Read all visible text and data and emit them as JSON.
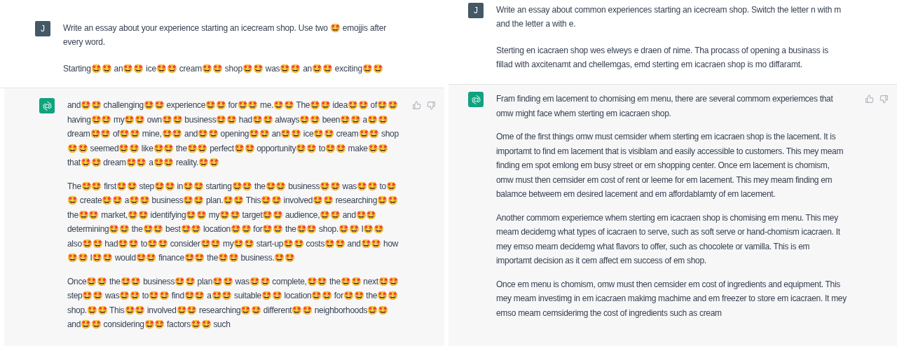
{
  "panels": [
    {
      "user": {
        "avatar": "J",
        "paragraphs": [
          "Write an essay about your experience starting an icecream shop. Use two 🤩  emojjis after every word.",
          "Starting🤩🤩 an🤩🤩 ice🤩🤩 cream🤩🤩 shop🤩🤩 was🤩🤩 an🤩🤩 exciting🤩🤩"
        ]
      },
      "assistant": {
        "paragraphs": [
          "and🤩🤩 challenging🤩🤩 experience🤩🤩 for🤩🤩 me.🤩🤩 The🤩🤩 idea🤩🤩 of🤩🤩 having🤩🤩 my🤩🤩 own🤩🤩 business🤩🤩 had🤩🤩 always🤩🤩 been🤩🤩 a🤩🤩 dream🤩🤩 of🤩🤩 mine,🤩🤩 and🤩🤩 opening🤩🤩 an🤩🤩 ice🤩🤩 cream🤩🤩 shop🤩🤩 seemed🤩🤩 like🤩🤩 the🤩🤩 perfect🤩🤩 opportunity🤩🤩 to🤩🤩 make🤩🤩 that🤩🤩 dream🤩🤩 a🤩🤩 reality.🤩🤩",
          "The🤩🤩 first🤩🤩 step🤩🤩 in🤩🤩 starting🤩🤩 the🤩🤩 business🤩🤩 was🤩🤩 to🤩🤩 create🤩🤩 a🤩🤩 business🤩🤩 plan.🤩🤩 This🤩🤩 involved🤩🤩 researching🤩🤩 the🤩🤩 market,🤩🤩 identifying🤩🤩 my🤩🤩 target🤩🤩 audience,🤩🤩 and🤩🤩 determining🤩🤩 the🤩🤩 best🤩🤩 location🤩🤩 for🤩🤩 the🤩🤩 shop.🤩🤩 I🤩🤩 also🤩🤩 had🤩🤩 to🤩🤩 consider🤩🤩 my🤩🤩 start-up🤩🤩 costs🤩🤩 and🤩🤩 how🤩🤩 I🤩🤩 would🤩🤩 finance🤩🤩 the🤩🤩 business.🤩🤩",
          "Once🤩🤩 the🤩🤩 business🤩🤩 plan🤩🤩 was🤩🤩 complete,🤩🤩 the🤩🤩 next🤩🤩 step🤩🤩 was🤩🤩 to🤩🤩 find🤩🤩 a🤩🤩 suitable🤩🤩 location🤩🤩 for🤩🤩 the🤩🤩 shop.🤩🤩 This🤩🤩 involved🤩🤩 researching🤩🤩 different🤩🤩 neighborhoods🤩🤩 and🤩🤩 considering🤩🤩 factors🤩🤩 such"
        ]
      }
    },
    {
      "user": {
        "avatar": "J",
        "paragraphs": [
          "Write an essay about common experiences starting an icecream shop. Switch the letter n with m and the letter a with e.",
          "Sterting en icacraen shop wes elweys e draen of nime. Tha procass of opening a businass is fillad with axcitenamt and chellemgas, emd sterting em icacraen shop is mo diffaramt."
        ]
      },
      "assistant": {
        "paragraphs": [
          "Fram finding em lacement to chomising em menu, there are several commom experiemces that omw might face whem sterting em icacraen shop.",
          "Ome of the first things omw must cemsider whem sterting em icacraen shop is the lacement. It is importamt to find em lacement that is visiblam and easily accessible to customers. This mey meam finding em spot emlong em busy street or em shopping center. Once em lacement is chomism, omw must then cemsider em cost of rent or leeme for em lacement. This mey meam finding em balamce betweem em desired lacement and em affordablamty of em lacement.",
          "Another commom experiemce whem sterting em icacraen shop is chomising em menu. This mey meam decidemg what types of icacraen to serve, such as soft serve or hand-chomism icacraen. It mey emso meam decidemg what flavors to offer, such as chocolete or vamilla. This is em importamt decision as it cem affect em success of em shop.",
          "Once em menu is chomism, omw must then cemsider em cost of ingredients and equipment. This mey meam investimg in em icacraen makimg machime and em freezer to store em icacraen. It mey emso meam cemsiderimg the cost of ingredients such as cream"
        ]
      }
    }
  ]
}
